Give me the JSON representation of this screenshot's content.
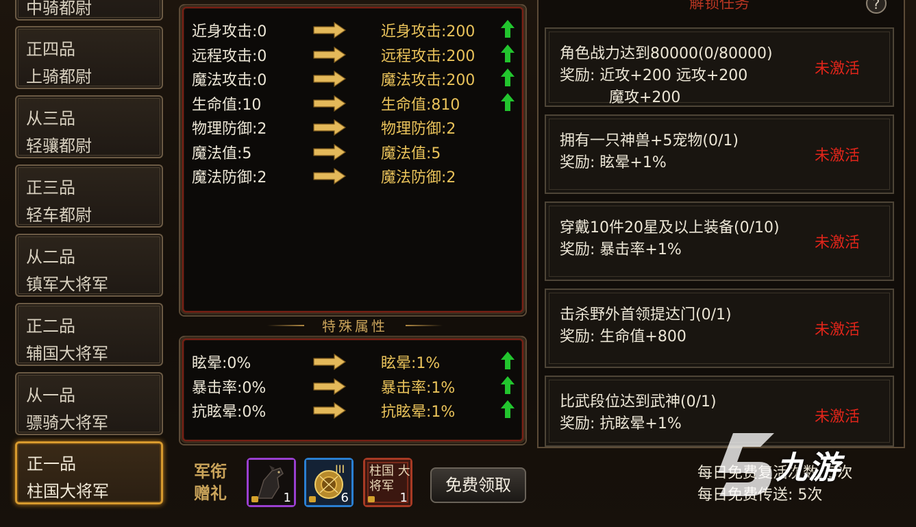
{
  "ranks": [
    {
      "grade": "",
      "title": "中骑都尉"
    },
    {
      "grade": "正四品",
      "title": "上骑都尉"
    },
    {
      "grade": "从三品",
      "title": "轻骧都尉"
    },
    {
      "grade": "正三品",
      "title": "轻车都尉"
    },
    {
      "grade": "从二品",
      "title": "镇军大将军"
    },
    {
      "grade": "正二品",
      "title": "辅国大将军"
    },
    {
      "grade": "从一品",
      "title": "骠骑大将军"
    },
    {
      "grade": "正一品",
      "title": "柱国大将军"
    }
  ],
  "selected_rank_index": 7,
  "base_stats": [
    {
      "from": "近身攻击:0",
      "to": "近身攻击:200",
      "up": true
    },
    {
      "from": "远程攻击:0",
      "to": "远程攻击:200",
      "up": true
    },
    {
      "from": "魔法攻击:0",
      "to": "魔法攻击:200",
      "up": true
    },
    {
      "from": "生命值:10",
      "to": "生命值:810",
      "up": true
    },
    {
      "from": "物理防御:2",
      "to": "物理防御:2",
      "up": false
    },
    {
      "from": "魔法值:5",
      "to": "魔法值:5",
      "up": false
    },
    {
      "from": "魔法防御:2",
      "to": "魔法防御:2",
      "up": false
    }
  ],
  "special_title": "特殊属性",
  "special_stats": [
    {
      "from": "眩晕:0%",
      "to": "眩晕:1%",
      "up": true
    },
    {
      "from": "暴击率:0%",
      "to": "暴击率:1%",
      "up": true
    },
    {
      "from": "抗眩晕:0%",
      "to": "抗眩晕:1%",
      "up": true
    }
  ],
  "task_header": "解锁任务",
  "help_label": "?",
  "tasks": [
    {
      "title": "角色战力达到80000(0/80000)",
      "reward": "奖励: 近攻+200      远攻+200",
      "reward2": "魔攻+200",
      "status": "未激活"
    },
    {
      "title": "拥有一只神兽+5宠物(0/1)",
      "reward": "奖励: 眩晕+1%",
      "reward2": "",
      "status": "未激活"
    },
    {
      "title": "穿戴10件20星及以上装备(0/10)",
      "reward": "奖励: 暴击率+1%",
      "reward2": "",
      "status": "未激活"
    },
    {
      "title": "击杀野外首领提达门(0/1)",
      "reward": "奖励: 生命值+800",
      "reward2": "",
      "status": "未激活"
    },
    {
      "title": "比武段位达到武神(0/1)",
      "reward": "奖励: 抗眩晕+1%",
      "reward2": "",
      "status": "未激活"
    }
  ],
  "gift": {
    "label_line1": "军衔",
    "label_line2": "赠礼",
    "items": [
      {
        "icon": "horse-mount-icon",
        "count": "1",
        "roman": "",
        "text": ""
      },
      {
        "icon": "gold-orb-icon",
        "count": "6",
        "roman": "III",
        "text": ""
      },
      {
        "icon": "title-badge-icon",
        "count": "1",
        "roman": "",
        "text": "柱国 大将军"
      }
    ],
    "claim_label": "免费领取"
  },
  "info": {
    "revive": "每日免费复活次数: 3次",
    "teleport": "每日免费传送: 5次"
  },
  "watermark": "九游",
  "colors": {
    "accent_gold": "#e9c25a",
    "status_red": "#e0251a",
    "up_green": "#22c52e",
    "selected_border": "#d79a2e"
  }
}
